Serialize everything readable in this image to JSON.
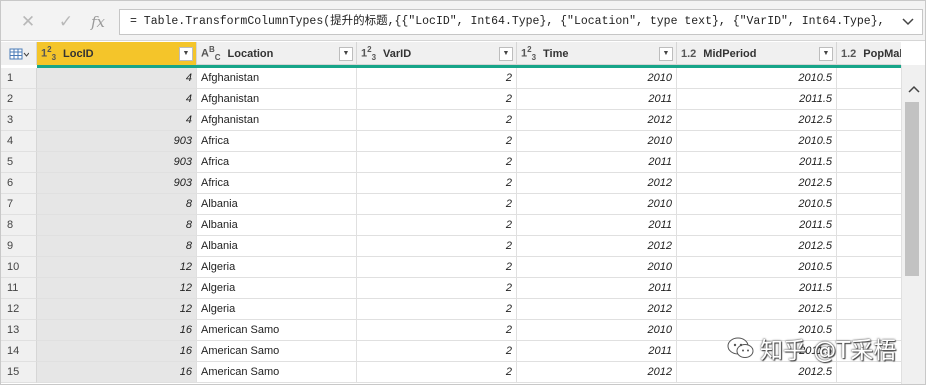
{
  "formula_bar": {
    "formula": "= Table.TransformColumnTypes(提升的标题,{{\"LocID\", Int64.Type}, {\"Location\", type text}, {\"VarID\", Int64.Type},"
  },
  "columns": [
    {
      "type_icon": "int",
      "name": "LocID"
    },
    {
      "type_icon": "text",
      "name": "Location"
    },
    {
      "type_icon": "int",
      "name": "VarID"
    },
    {
      "type_icon": "int",
      "name": "Time"
    },
    {
      "type_icon": "decimal",
      "name": "MidPeriod"
    },
    {
      "type_icon": "decimal",
      "name": "PopMale"
    }
  ],
  "rows": [
    {
      "num": "1",
      "LocID": "4",
      "Location": "Afghanistan",
      "VarID": "2",
      "Time": "2010",
      "MidPeriod": "2010.5"
    },
    {
      "num": "2",
      "LocID": "4",
      "Location": "Afghanistan",
      "VarID": "2",
      "Time": "2011",
      "MidPeriod": "2011.5"
    },
    {
      "num": "3",
      "LocID": "4",
      "Location": "Afghanistan",
      "VarID": "2",
      "Time": "2012",
      "MidPeriod": "2012.5"
    },
    {
      "num": "4",
      "LocID": "903",
      "Location": "Africa",
      "VarID": "2",
      "Time": "2010",
      "MidPeriod": "2010.5"
    },
    {
      "num": "5",
      "LocID": "903",
      "Location": "Africa",
      "VarID": "2",
      "Time": "2011",
      "MidPeriod": "2011.5"
    },
    {
      "num": "6",
      "LocID": "903",
      "Location": "Africa",
      "VarID": "2",
      "Time": "2012",
      "MidPeriod": "2012.5"
    },
    {
      "num": "7",
      "LocID": "8",
      "Location": "Albania",
      "VarID": "2",
      "Time": "2010",
      "MidPeriod": "2010.5"
    },
    {
      "num": "8",
      "LocID": "8",
      "Location": "Albania",
      "VarID": "2",
      "Time": "2011",
      "MidPeriod": "2011.5"
    },
    {
      "num": "9",
      "LocID": "8",
      "Location": "Albania",
      "VarID": "2",
      "Time": "2012",
      "MidPeriod": "2012.5"
    },
    {
      "num": "10",
      "LocID": "12",
      "Location": "Algeria",
      "VarID": "2",
      "Time": "2010",
      "MidPeriod": "2010.5"
    },
    {
      "num": "11",
      "LocID": "12",
      "Location": "Algeria",
      "VarID": "2",
      "Time": "2011",
      "MidPeriod": "2011.5"
    },
    {
      "num": "12",
      "LocID": "12",
      "Location": "Algeria",
      "VarID": "2",
      "Time": "2012",
      "MidPeriod": "2012.5"
    },
    {
      "num": "13",
      "LocID": "16",
      "Location": "American Samo",
      "VarID": "2",
      "Time": "2010",
      "MidPeriod": "2010.5"
    },
    {
      "num": "14",
      "LocID": "16",
      "Location": "American Samo",
      "VarID": "2",
      "Time": "2011",
      "MidPeriod": "2011.5"
    },
    {
      "num": "15",
      "LocID": "16",
      "Location": "American Samo",
      "VarID": "2",
      "Time": "2012",
      "MidPeriod": "2012.5"
    }
  ],
  "watermark": {
    "text": "知乎 @T采梧"
  },
  "colors": {
    "selected_header": "#f4c52a",
    "quality_bar": "#17a589"
  }
}
